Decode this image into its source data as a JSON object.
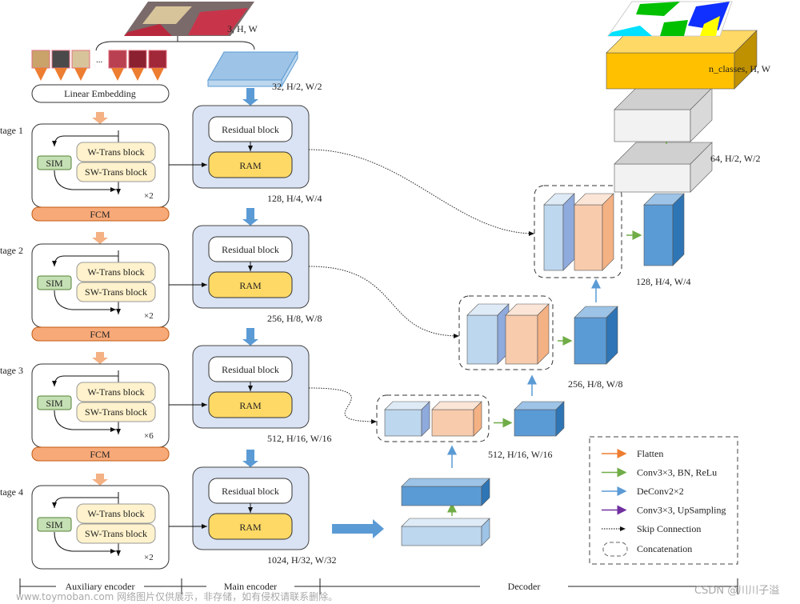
{
  "input": {
    "label": "3, H, W"
  },
  "patch_ellipsis": "...",
  "linear_embedding": "Linear Embedding",
  "stage_labels": [
    "tage 1",
    "tage 2",
    "tage 3",
    "tage 4"
  ],
  "aux_stage": {
    "sim": "SIM",
    "w_trans": "W-Trans block",
    "sw_trans": "SW-Trans block",
    "fcm": "FCM"
  },
  "repeats": [
    "×2",
    "×2",
    "×6",
    "×2"
  ],
  "main_encoder": {
    "stem_label": "32, H/2, W/2",
    "residual": "Residual block",
    "ram": "RAM",
    "outputs": [
      "128, H/4, W/4",
      "256, H/8, W/8",
      "512, H/16, W/16",
      "1024, H/32, W/32"
    ]
  },
  "decoder": {
    "labels": [
      "512, H/16, W/16",
      "256, H/8, W/8",
      "128, H/4, W/4",
      "64, H/2, W/2",
      "n_classes, H, W"
    ]
  },
  "legend": {
    "items": [
      {
        "label": "Flatten",
        "color": "#ed7d31"
      },
      {
        "label": "Conv3×3, BN, ReLu",
        "color": "#70ad47"
      },
      {
        "label": "DeConv2×2",
        "color": "#5b9bd5"
      },
      {
        "label": "Conv3×3, UpSampling",
        "color": "#7030a0"
      },
      {
        "label": "Skip Connection",
        "color": "#000000"
      },
      {
        "label": "Concatenation",
        "color": "#666666"
      }
    ]
  },
  "sections": [
    "Auxiliary encoder",
    "Main encoder",
    "Decoder"
  ],
  "watermarks": [
    "www.toymoban.com 网络图片仅供展示，非存储，如有侵权请联系删除。",
    "CSDN @川川子溢"
  ],
  "colors": {
    "orange": "#f4b183",
    "fcm": "#f8a978",
    "blue_box": "#dae3f3",
    "ram": "#ffd966",
    "trans": "#fff2cc",
    "sim": "#c5e0b4",
    "light_blue": "#bdd7ee",
    "mid_blue": "#5b9bd5",
    "yellow": "#ffc000"
  }
}
